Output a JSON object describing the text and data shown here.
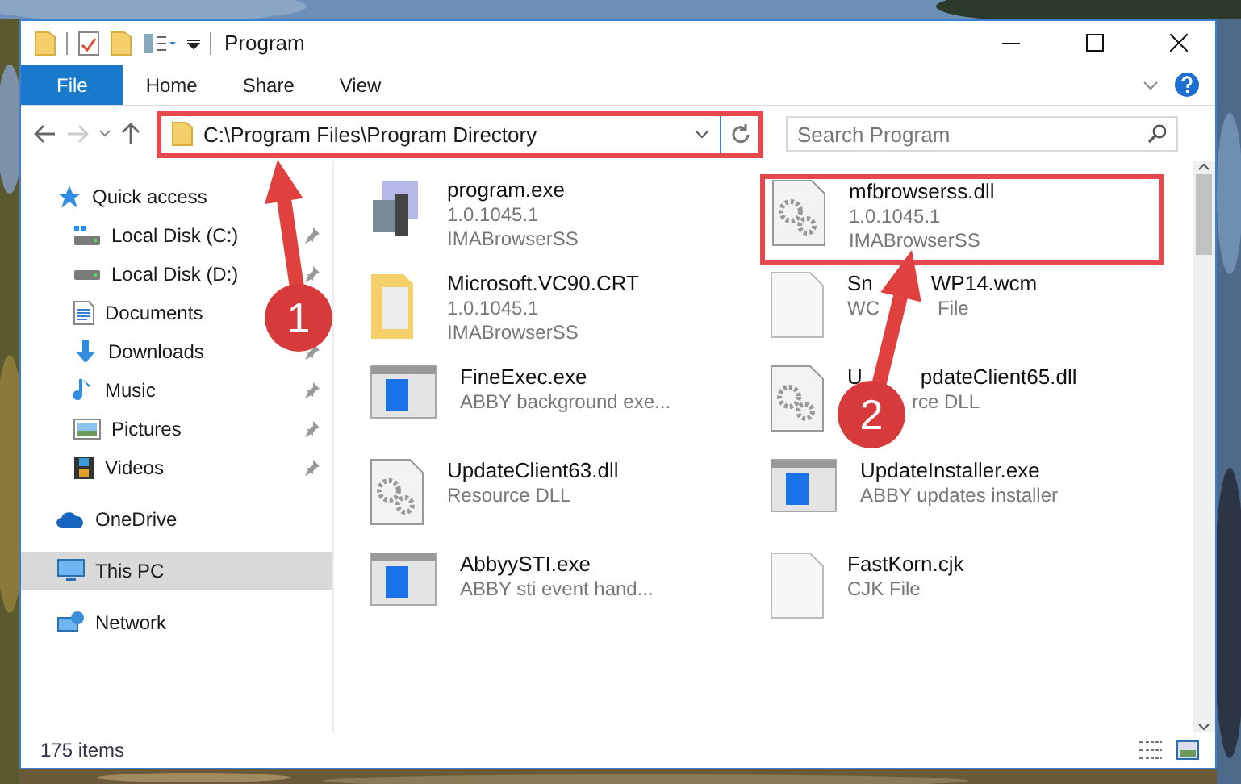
{
  "window": {
    "title": "Program"
  },
  "ribbon_tabs": [
    {
      "label": "File",
      "kind": "file"
    },
    {
      "label": "Home",
      "kind": "tab"
    },
    {
      "label": "Share",
      "kind": "tab"
    },
    {
      "label": "View",
      "kind": "tab"
    }
  ],
  "address": {
    "path": "C:\\Program Files\\Program Directory",
    "highlighted": true
  },
  "search": {
    "placeholder": "Search Program"
  },
  "sidebar": {
    "items": [
      {
        "label": "Quick access",
        "selected": false,
        "children": [
          {
            "label": "Local Disk (C:)",
            "selected": false,
            "pinned": true
          },
          {
            "label": "Local Disk (D:)",
            "selected": false,
            "pinned": true
          },
          {
            "label": "Documents",
            "selected": false
          },
          {
            "label": "Downloads",
            "selected": false,
            "pinned": true
          },
          {
            "label": "Music",
            "selected": false,
            "pinned": true
          },
          {
            "label": "Pictures",
            "selected": false,
            "pinned": true
          },
          {
            "label": "Videos",
            "selected": false,
            "pinned": true
          }
        ]
      },
      {
        "label": "OneDrive",
        "selected": false
      },
      {
        "label": "This PC",
        "selected": true
      },
      {
        "label": "Network",
        "selected": false
      }
    ]
  },
  "files": [
    {
      "name": [
        "program.exe"
      ],
      "details": [
        [
          "1.0.1045.1"
        ],
        [
          "IMABrowserSS"
        ]
      ],
      "highlighted": false
    },
    {
      "name": [
        "mfbrowserss.dll"
      ],
      "details": [
        [
          "1.0.1045.1"
        ],
        [
          "IMABrowserSS"
        ]
      ],
      "highlighted": true
    },
    {
      "name": [
        "Microsoft.VC90.CRT"
      ],
      "details": [
        [
          "1.0.1045.1"
        ],
        [
          "IMABrowserSS"
        ]
      ],
      "highlighted": false
    },
    {
      "name": [
        "Sn",
        "WP14.wcm"
      ],
      "details": [
        [
          "WC",
          "File"
        ]
      ],
      "highlighted": false
    },
    {
      "name": [
        "FineExec.exe"
      ],
      "details": [
        [
          "ABBY background exe..."
        ]
      ],
      "highlighted": false
    },
    {
      "name": [
        "U",
        "pdateClient65.dll"
      ],
      "details": [
        [
          "rce DLL"
        ]
      ],
      "highlighted": false,
      "covered_start": true
    },
    {
      "name": [
        "UpdateClient63.dll"
      ],
      "details": [
        [
          "Resource DLL"
        ]
      ],
      "highlighted": false
    },
    {
      "name": [
        "UpdateInstaller.exe"
      ],
      "details": [
        [
          "ABBY updates installer"
        ]
      ],
      "highlighted": false
    },
    {
      "name": [
        "AbbyySTI.exe"
      ],
      "details": [
        [
          "ABBY sti event hand..."
        ]
      ],
      "highlighted": false
    },
    {
      "name": [
        "FastKorn.cjk"
      ],
      "details": [
        [
          "CJK File"
        ]
      ],
      "highlighted": false
    }
  ],
  "status_bar": {
    "item_count": "175 items"
  },
  "annotations": [
    {
      "label": "1"
    },
    {
      "label": "2"
    }
  ]
}
